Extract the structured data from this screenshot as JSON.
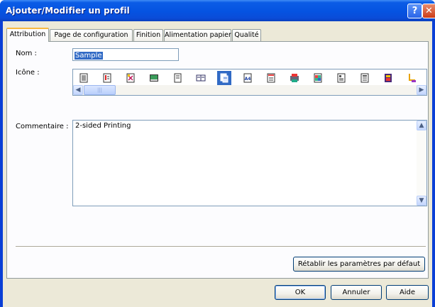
{
  "window": {
    "title": "Ajouter/Modifier un profil",
    "help_glyph": "?",
    "close_glyph": "✕"
  },
  "tabs": [
    {
      "label": "Attribution",
      "active": true
    },
    {
      "label": "Page de configuration",
      "active": false
    },
    {
      "label": "Finition",
      "active": false
    },
    {
      "label": "Alimentation papier",
      "active": false
    },
    {
      "label": "Qualité",
      "active": false
    }
  ],
  "form": {
    "name_label": "Nom :",
    "name_value": "Sample",
    "icon_label": "Icône :",
    "comment_label": "Commentaire :",
    "comment_value": "2-sided Printing",
    "icons": [
      "document-lines-icon",
      "document-red-icon",
      "document-no-staple-icon",
      "photo-icon",
      "document-small-icon",
      "two-pages-icon",
      "duplex-icon",
      "a4-icon",
      "document-dots-icon",
      "color-print-icon",
      "color-image-icon",
      "document-text-icon",
      "document-text-2-icon",
      "booklet-color-icon",
      "stapled-corner-icon"
    ],
    "selected_icon": 6
  },
  "buttons": {
    "reset": "Rétablir les paramètres par défaut",
    "ok": "OK",
    "cancel": "Annuler",
    "help": "Aide"
  },
  "colors": {
    "titlebar": "#0553e1",
    "selection": "#316ac5",
    "dialog_bg": "#ece9d8"
  }
}
